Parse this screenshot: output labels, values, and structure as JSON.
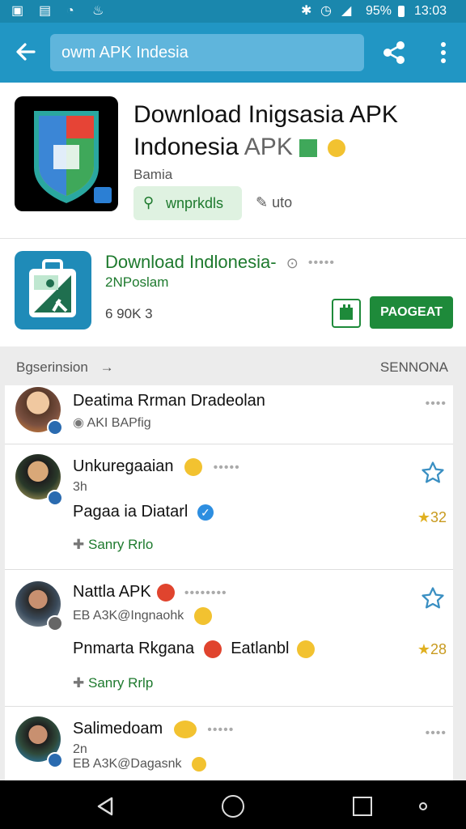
{
  "status_bar": {
    "battery": "95%",
    "time": "13:03"
  },
  "app_bar": {
    "search_text": "owm APK Indesia"
  },
  "header": {
    "title_line1": "Download Inigsasia APK",
    "title_line2": "Indonesia",
    "title_suffix": "APK",
    "publisher": "Bamia",
    "chip_label": "wnprkdls",
    "secondary_label": "uto"
  },
  "card2": {
    "title": "Download Indlonesia-",
    "subtitle": "2NPoslam",
    "meta": "6 90K 3",
    "get_label": "PAOGEAT"
  },
  "reviews": {
    "header_left": "Bgserinsion",
    "header_left_arrow": "→",
    "header_right": "SENNONA",
    "items": [
      {
        "name": "Deatima Rrman Dradeolan",
        "sub": "AKI BAPfig",
        "text": "",
        "reply": "",
        "score": ""
      },
      {
        "name": "Unkuregaaian",
        "sub": "3h",
        "text": "Pagaa ia Diatarl",
        "reply": "Sanry Rrlo",
        "score": "32"
      },
      {
        "name": "Nattla APK",
        "sub": "EB A3K@Ingnaohk",
        "text": "Pnmarta Rkgana",
        "text2": "Eatlanbl",
        "reply": "Sanry Rrlp",
        "score": "28"
      },
      {
        "name": "Salimedoam",
        "sub": "2n",
        "sub2": "EB A3K@Dagasnk",
        "text": "",
        "reply": "",
        "score": ""
      }
    ]
  },
  "colors": {
    "status_bar": "#1a87ad",
    "app_bar": "#2196c4",
    "search_field": "#5fb5dc",
    "accent_green": "#1e8a3a",
    "star_outline": "#3a8fc2",
    "star_filled": "#e0b020"
  },
  "icons": {
    "back": "back-arrow-icon",
    "share": "share-icon",
    "more": "overflow-menu-icon"
  }
}
